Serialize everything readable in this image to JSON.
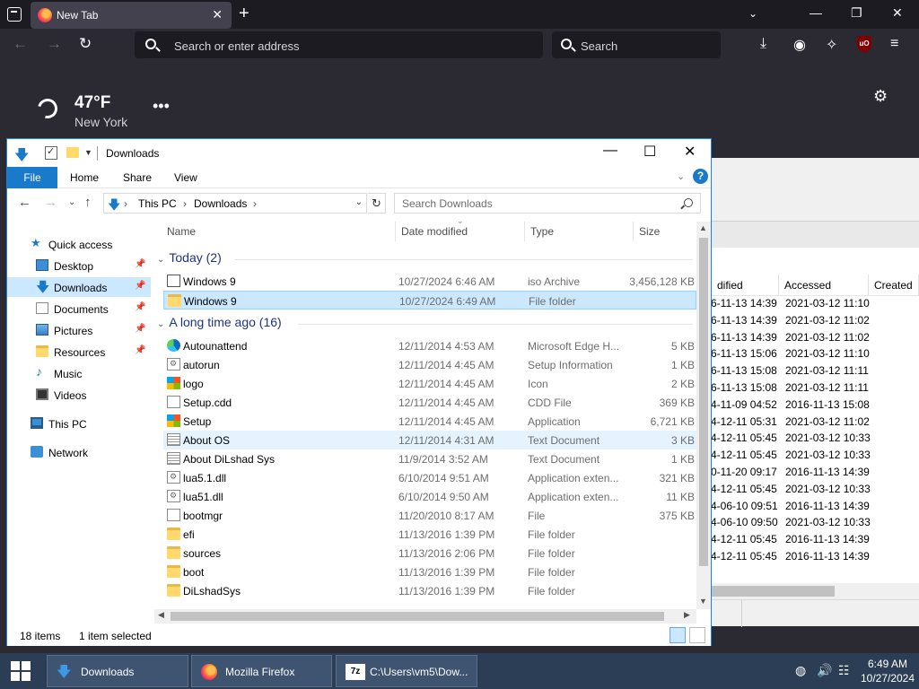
{
  "firefox": {
    "tab_title": "New Tab",
    "address_placeholder": "Search or enter address",
    "search_placeholder": "Search",
    "weather": {
      "temperature": "47°F",
      "city": "New York"
    }
  },
  "explorer": {
    "title": "Downloads",
    "ribbon_tabs": [
      "File",
      "Home",
      "Share",
      "View"
    ],
    "breadcrumb": [
      "This PC",
      "Downloads"
    ],
    "search_placeholder": "Search Downloads",
    "nav_items": [
      {
        "label": "Quick access",
        "icon": "star-icon"
      },
      {
        "label": "Desktop",
        "icon": "desktop-icon",
        "pinned": true
      },
      {
        "label": "Downloads",
        "icon": "download-icon",
        "pinned": true,
        "selected": true
      },
      {
        "label": "Documents",
        "icon": "document-icon",
        "pinned": true
      },
      {
        "label": "Pictures",
        "icon": "pictures-icon",
        "pinned": true
      },
      {
        "label": "Resources",
        "icon": "folder-icon",
        "pinned": true
      },
      {
        "label": "Music",
        "icon": "music-icon"
      },
      {
        "label": "Videos",
        "icon": "video-icon"
      },
      {
        "label": "This PC",
        "icon": "computer-icon"
      },
      {
        "label": "Network",
        "icon": "network-icon"
      }
    ],
    "columns": [
      "Name",
      "Date modified",
      "Type",
      "Size"
    ],
    "groups": [
      {
        "label": "Today (2)",
        "files": [
          {
            "name": "Windows 9",
            "date": "10/27/2024 6:46 AM",
            "type": "iso Archive",
            "size": "3,456,128 KB",
            "icon": "iso"
          },
          {
            "name": "Windows 9",
            "date": "10/27/2024 6:49 AM",
            "type": "File folder",
            "size": "",
            "icon": "folder",
            "selected": true
          }
        ]
      },
      {
        "label": "A long time ago (16)",
        "files": [
          {
            "name": "Autounattend",
            "date": "12/11/2014 4:53 AM",
            "type": "Microsoft Edge H...",
            "size": "5 KB",
            "icon": "edge"
          },
          {
            "name": "autorun",
            "date": "12/11/2014 4:45 AM",
            "type": "Setup Information",
            "size": "1 KB",
            "icon": "setupinf"
          },
          {
            "name": "logo",
            "date": "12/11/2014 4:45 AM",
            "type": "Icon",
            "size": "2 KB",
            "icon": "winlogo"
          },
          {
            "name": "Setup.cdd",
            "date": "12/11/2014 4:45 AM",
            "type": "CDD File",
            "size": "369 KB",
            "icon": "doc"
          },
          {
            "name": "Setup",
            "date": "12/11/2014 4:45 AM",
            "type": "Application",
            "size": "6,721 KB",
            "icon": "winlogo"
          },
          {
            "name": "About OS",
            "date": "12/11/2014 4:31 AM",
            "type": "Text Document",
            "size": "3 KB",
            "icon": "text",
            "hover": true
          },
          {
            "name": "About DiLshad Sys",
            "date": "11/9/2014 3:52 AM",
            "type": "Text Document",
            "size": "1 KB",
            "icon": "text"
          },
          {
            "name": "lua5.1.dll",
            "date": "6/10/2014 9:51 AM",
            "type": "Application exten...",
            "size": "321 KB",
            "icon": "dll"
          },
          {
            "name": "lua51.dll",
            "date": "6/10/2014 9:50 AM",
            "type": "Application exten...",
            "size": "11 KB",
            "icon": "dll"
          },
          {
            "name": "bootmgr",
            "date": "11/20/2010 8:17 AM",
            "type": "File",
            "size": "375 KB",
            "icon": "doc"
          },
          {
            "name": "efi",
            "date": "11/13/2016 1:39 PM",
            "type": "File folder",
            "size": "",
            "icon": "folder"
          },
          {
            "name": "sources",
            "date": "11/13/2016 2:06 PM",
            "type": "File folder",
            "size": "",
            "icon": "folder"
          },
          {
            "name": "boot",
            "date": "11/13/2016 1:39 PM",
            "type": "File folder",
            "size": "",
            "icon": "folder"
          },
          {
            "name": "DiLshadSys",
            "date": "11/13/2016 1:39 PM",
            "type": "File folder",
            "size": "",
            "icon": "folder"
          }
        ]
      }
    ],
    "status": {
      "items": "18 items",
      "selected": "1 item selected"
    }
  },
  "zip": {
    "columns": [
      "dified",
      "Accessed",
      "Created"
    ],
    "rows": [
      [
        "6-11-13 14:39",
        "2021-03-12 11:10"
      ],
      [
        "6-11-13 14:39",
        "2021-03-12 11:02"
      ],
      [
        "6-11-13 14:39",
        "2021-03-12 11:02"
      ],
      [
        "6-11-13 15:06",
        "2021-03-12 11:10"
      ],
      [
        "6-11-13 15:08",
        "2021-03-12 11:11"
      ],
      [
        "6-11-13 15:08",
        "2021-03-12 11:11"
      ],
      [
        "4-11-09 04:52",
        "2016-11-13 15:08"
      ],
      [
        "4-12-11 05:31",
        "2021-03-12 11:02"
      ],
      [
        "4-12-11 05:45",
        "2021-03-12 10:33"
      ],
      [
        "4-12-11 05:45",
        "2021-03-12 10:33"
      ],
      [
        "0-11-20 09:17",
        "2016-11-13 14:39"
      ],
      [
        "4-12-11 05:45",
        "2021-03-12 10:33"
      ],
      [
        "4-06-10 09:51",
        "2016-11-13 14:39"
      ],
      [
        "4-06-10 09:50",
        "2021-03-12 10:33"
      ],
      [
        "4-12-11 05:45",
        "2016-11-13 14:39"
      ],
      [
        "4-12-11 05:45",
        "2016-11-13 14:39"
      ]
    ]
  },
  "taskbar": {
    "buttons": [
      {
        "label": "Downloads",
        "icon": "explorer-icon"
      },
      {
        "label": "Mozilla Firefox",
        "icon": "firefox-icon"
      },
      {
        "label": "C:\\Users\\vm5\\Dow...",
        "icon": "7zip-icon"
      }
    ],
    "time": "6:49 AM",
    "date": "10/27/2024"
  }
}
